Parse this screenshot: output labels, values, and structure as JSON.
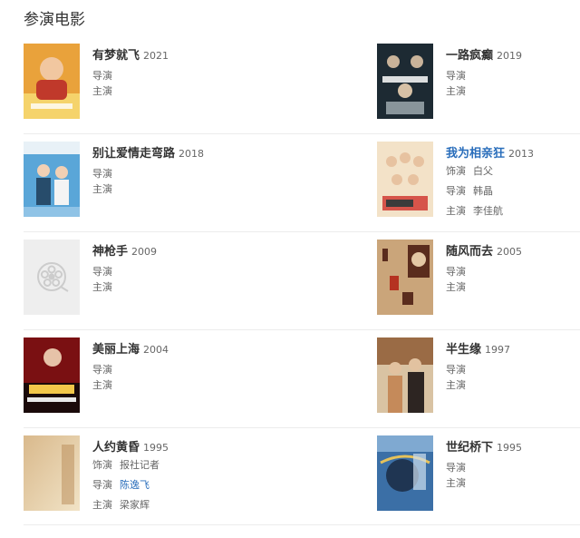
{
  "section": {
    "title": "参演电影"
  },
  "movies": [
    {
      "title": "有梦就飞",
      "year": "2021",
      "link": false,
      "credits": [
        {
          "role": "导演",
          "name": ""
        },
        {
          "role": "主演",
          "name": ""
        }
      ],
      "poster": {
        "icon": "poster-man-bald",
        "palette": [
          "#e9a23b",
          "#c0392b",
          "#f5d36b"
        ]
      }
    },
    {
      "title": "一路疯癫",
      "year": "2019",
      "link": false,
      "credits": [
        {
          "role": "导演",
          "name": ""
        },
        {
          "role": "主演",
          "name": ""
        }
      ],
      "poster": {
        "icon": "poster-group-dark",
        "palette": [
          "#1d2a33",
          "#b8c3c8",
          "#f2f2f2"
        ]
      }
    },
    {
      "title": "别让爱情走弯路",
      "year": "2018",
      "link": false,
      "credits": [
        {
          "role": "导演",
          "name": ""
        },
        {
          "role": "主演",
          "name": ""
        }
      ],
      "poster": {
        "icon": "poster-couple-blue",
        "palette": [
          "#5aa6d8",
          "#e8f1f7",
          "#274c6b"
        ]
      }
    },
    {
      "title": "我为相亲狂",
      "year": "2013",
      "link": true,
      "credits": [
        {
          "role": "饰演",
          "name": "白父",
          "name_link": false
        },
        {
          "role": "导演",
          "name": "韩晶",
          "name_link": false
        },
        {
          "role": "主演",
          "name": "李佳航",
          "name_link": false
        }
      ],
      "poster": {
        "icon": "poster-group-red",
        "palette": [
          "#d6544a",
          "#f3e2c8",
          "#3b3b3b"
        ]
      }
    },
    {
      "title": "神枪手",
      "year": "2009",
      "link": false,
      "credits": [
        {
          "role": "导演",
          "name": ""
        },
        {
          "role": "主演",
          "name": ""
        }
      ],
      "poster": {
        "icon": "film-reel-placeholder-icon",
        "palette": [
          "#eeeeee",
          "#cccccc",
          "#ffffff"
        ]
      }
    },
    {
      "title": "随风而去",
      "year": "2005",
      "link": false,
      "credits": [
        {
          "role": "导演",
          "name": ""
        },
        {
          "role": "主演",
          "name": ""
        }
      ],
      "poster": {
        "icon": "poster-calligraphy",
        "palette": [
          "#caa57a",
          "#5a2c1d",
          "#b53221"
        ]
      }
    },
    {
      "title": "美丽上海",
      "year": "2004",
      "link": false,
      "credits": [
        {
          "role": "导演",
          "name": ""
        },
        {
          "role": "主演",
          "name": ""
        }
      ],
      "poster": {
        "icon": "poster-shanghai",
        "palette": [
          "#7a1012",
          "#1a0a0a",
          "#f2c74a"
        ]
      }
    },
    {
      "title": "半生缘",
      "year": "1997",
      "link": false,
      "credits": [
        {
          "role": "导演",
          "name": ""
        },
        {
          "role": "主演",
          "name": ""
        }
      ],
      "poster": {
        "icon": "poster-couple-warm",
        "palette": [
          "#9a6b45",
          "#2d2522",
          "#d9c3a3"
        ]
      }
    },
    {
      "title": "人约黄昏",
      "year": "1995",
      "link": false,
      "credits": [
        {
          "role": "饰演",
          "name": "报社记者",
          "name_link": false
        },
        {
          "role": "导演",
          "name": "陈逸飞",
          "name_link": true
        },
        {
          "role": "主演",
          "name": "梁家辉",
          "name_link": false
        }
      ],
      "poster": {
        "icon": "poster-sepia-fade",
        "palette": [
          "#d9b98c",
          "#f1e3c6",
          "#b78a55"
        ]
      }
    },
    {
      "title": "世纪桥下",
      "year": "1995",
      "link": false,
      "credits": [
        {
          "role": "导演",
          "name": ""
        },
        {
          "role": "主演",
          "name": ""
        }
      ],
      "poster": {
        "icon": "poster-bridge-blue",
        "palette": [
          "#3b6fa6",
          "#e6c25a",
          "#1f3552"
        ]
      }
    }
  ]
}
